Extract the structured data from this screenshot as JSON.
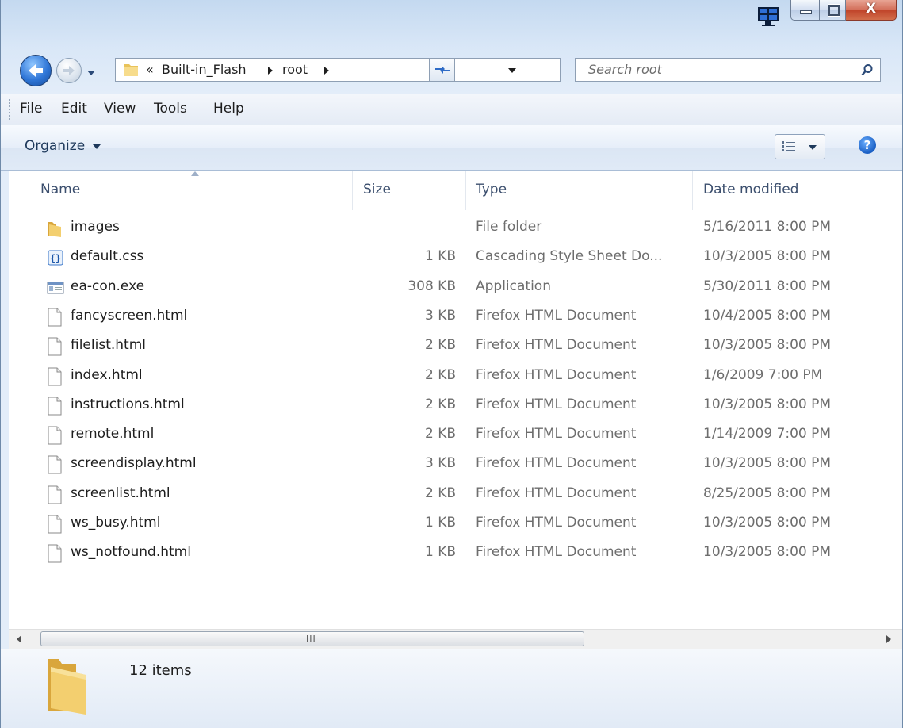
{
  "address": {
    "crumbs": [
      "Built-in_Flash",
      "root"
    ],
    "overflow": "«",
    "search_placeholder": "Search root"
  },
  "menu": [
    "File",
    "Edit",
    "View",
    "Tools",
    "Help"
  ],
  "command_bar": {
    "organize_label": "Organize"
  },
  "columns": {
    "name": "Name",
    "size": "Size",
    "type": "Type",
    "date": "Date modified"
  },
  "files": [
    {
      "name": "images",
      "size": "",
      "type": "File folder",
      "date": "5/16/2011 8:00 PM",
      "icon": "folder-icon"
    },
    {
      "name": "default.css",
      "size": "1 KB",
      "type": "Cascading Style Sheet Do...",
      "date": "10/3/2005 8:00 PM",
      "icon": "css-file-icon"
    },
    {
      "name": "ea-con.exe",
      "size": "308 KB",
      "type": "Application",
      "date": "5/30/2011 8:00 PM",
      "icon": "exe-file-icon"
    },
    {
      "name": "fancyscreen.html",
      "size": "3 KB",
      "type": "Firefox HTML Document",
      "date": "10/4/2005 8:00 PM",
      "icon": "html-file-icon"
    },
    {
      "name": "filelist.html",
      "size": "2 KB",
      "type": "Firefox HTML Document",
      "date": "10/3/2005 8:00 PM",
      "icon": "html-file-icon"
    },
    {
      "name": "index.html",
      "size": "2 KB",
      "type": "Firefox HTML Document",
      "date": "1/6/2009 7:00 PM",
      "icon": "html-file-icon"
    },
    {
      "name": "instructions.html",
      "size": "2 KB",
      "type": "Firefox HTML Document",
      "date": "10/3/2005 8:00 PM",
      "icon": "html-file-icon"
    },
    {
      "name": "remote.html",
      "size": "2 KB",
      "type": "Firefox HTML Document",
      "date": "1/14/2009 7:00 PM",
      "icon": "html-file-icon"
    },
    {
      "name": "screendisplay.html",
      "size": "3 KB",
      "type": "Firefox HTML Document",
      "date": "10/3/2005 8:00 PM",
      "icon": "html-file-icon"
    },
    {
      "name": "screenlist.html",
      "size": "2 KB",
      "type": "Firefox HTML Document",
      "date": "8/25/2005 8:00 PM",
      "icon": "html-file-icon"
    },
    {
      "name": "ws_busy.html",
      "size": "1 KB",
      "type": "Firefox HTML Document",
      "date": "10/3/2005 8:00 PM",
      "icon": "html-file-icon"
    },
    {
      "name": "ws_notfound.html",
      "size": "1 KB",
      "type": "Firefox HTML Document",
      "date": "10/3/2005 8:00 PM",
      "icon": "html-file-icon"
    }
  ],
  "details": {
    "item_count": "12 items"
  },
  "scrollbar": {
    "grip": "III"
  }
}
